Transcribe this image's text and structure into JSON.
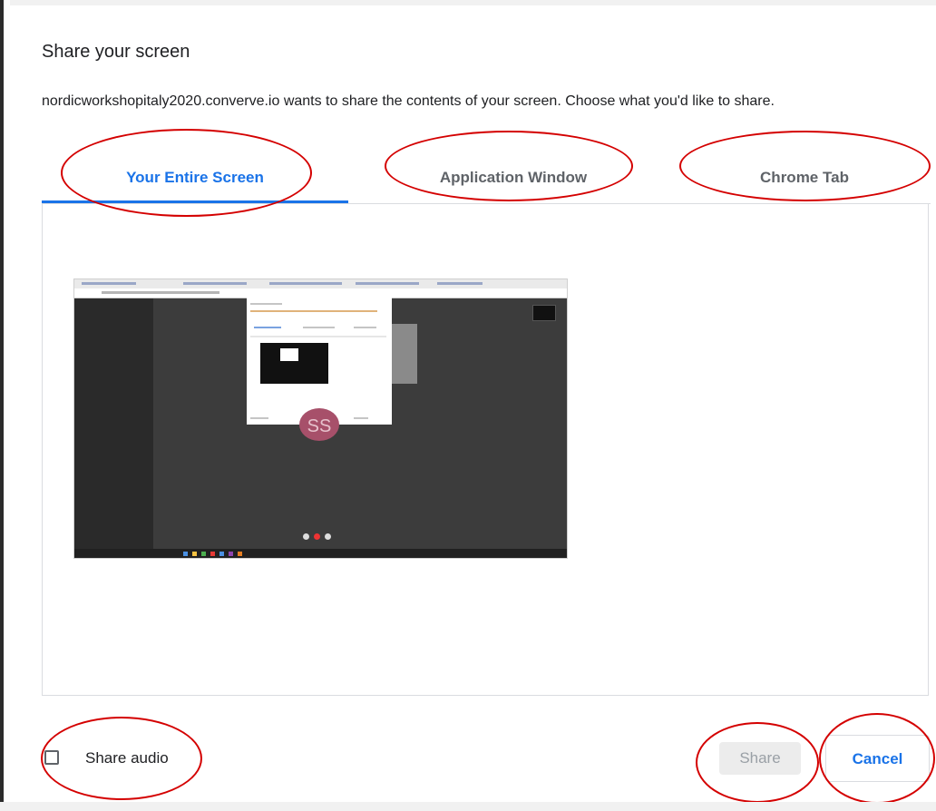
{
  "dialog": {
    "title": "Share your screen",
    "description": "nordicworkshopitaly2020.converve.io wants to share the contents of your screen. Choose what you'd like to share."
  },
  "tabs": [
    {
      "label": "Your Entire Screen",
      "active": true
    },
    {
      "label": "Application Window",
      "active": false
    },
    {
      "label": "Chrome Tab",
      "active": false
    }
  ],
  "preview": {
    "avatar_initials": "SS"
  },
  "audio": {
    "label": "Share audio",
    "checked": false
  },
  "buttons": {
    "share": "Share",
    "cancel": "Cancel"
  },
  "colors": {
    "accent": "#1a73e8",
    "annotation": "#d40000",
    "disabled_bg": "#ececec"
  }
}
